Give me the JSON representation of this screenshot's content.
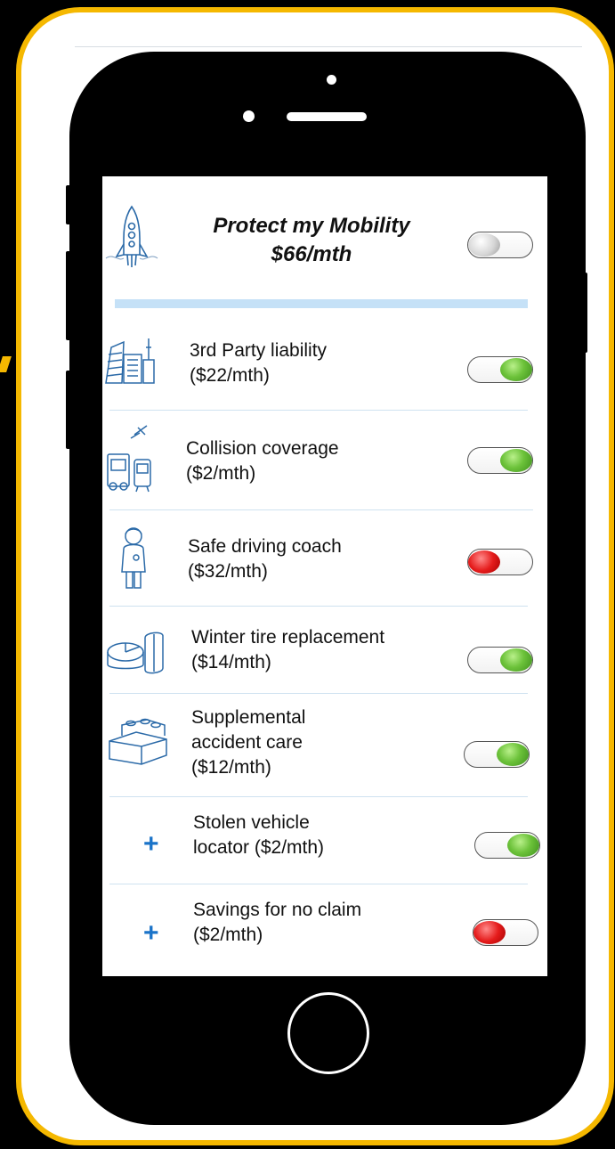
{
  "header": {
    "title_line1": "Protect my Mobility",
    "title_line2": "$66/mth",
    "toggle_state": "off-neutral",
    "icon": "rocket-icon"
  },
  "items": [
    {
      "label_line1": "3rd Party liability",
      "label_line2": "($22/mth)",
      "label_line3": "",
      "icon": "buildings-icon",
      "enabled": true
    },
    {
      "label_line1": "Collision coverage",
      "label_line2": "($2/mth)",
      "label_line3": "",
      "icon": "vehicles-icon",
      "enabled": true
    },
    {
      "label_line1": "Safe driving coach",
      "label_line2": "($32/mth)",
      "label_line3": "",
      "icon": "coach-person-icon",
      "enabled": false
    },
    {
      "label_line1": "Winter tire replacement",
      "label_line2": "($14/mth)",
      "label_line3": "",
      "icon": "pie-chart-icon",
      "enabled": true
    },
    {
      "label_line1": "Supplemental",
      "label_line2": "accident care",
      "label_line3": "($12/mth)",
      "icon": "blocks-icon",
      "enabled": true
    },
    {
      "label_line1": "Stolen vehicle",
      "label_line2": "locator ($2/mth)",
      "label_line3": "",
      "icon": "plus-icon",
      "enabled": true
    },
    {
      "label_line1": "Savings for no claim",
      "label_line2": "($2/mth)",
      "label_line3": "",
      "icon": "plus-icon",
      "enabled": false
    }
  ],
  "colors": {
    "frame_border": "#f5b800",
    "toggle_on": "#6cc23a",
    "toggle_off": "#e51c1c",
    "accent_bar": "#c5e1f7",
    "plus": "#1a73c8"
  }
}
